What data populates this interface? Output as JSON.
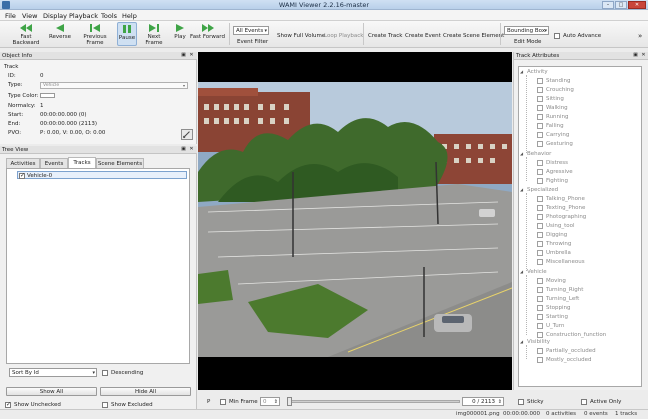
{
  "window": {
    "title": "WAMI Viewer 2.2.16-master"
  },
  "menu": [
    "File",
    "View",
    "Display",
    "Playback",
    "Tools",
    "Help"
  ],
  "toolbar": {
    "fast_backward": "Fast Backward",
    "reverse": "Reverse",
    "previous_frame": "Previous Frame",
    "pause": "Pause",
    "next_frame": "Next Frame",
    "play": "Play",
    "fast_forward": "Fast Forward",
    "event_filter_value": "All Events",
    "event_filter_label": "Event Filter",
    "show_full_volume": "Show Full Volume",
    "loop_playback": "Loop Playback",
    "create_track": "Create Track",
    "create_event": "Create Event",
    "create_scene_element": "Create Scene Element",
    "edit_mode_value": "Bounding Box",
    "edit_mode_label": "Edit Mode",
    "auto_advance": "Auto Advance",
    "overflow": "»"
  },
  "object_info": {
    "panel_title": "Object Info",
    "section": "Track",
    "id_label": "ID:",
    "id_value": "0",
    "type_label": "Type:",
    "type_value": "Vehicle",
    "type_color_label": "Type Color:",
    "normalcy_label": "Normalcy:",
    "normalcy_value": "1",
    "start_label": "Start:",
    "start_value": "00:00:00.000 (0)",
    "end_label": "End:",
    "end_value": "00:00:00.000 (2113)",
    "pvo_label": "PVO:",
    "pvo_value": "P: 0.00, V: 0.00, O: 0.00"
  },
  "tree_view": {
    "panel_title": "Tree View",
    "tabs": [
      "Activities",
      "Events",
      "Tracks",
      "Scene Elements"
    ],
    "active_tab": "Tracks",
    "items": [
      "Vehicle-0"
    ],
    "sort_value": "Sort By Id",
    "descending": "Descending",
    "show_all": "Show All",
    "hide_all": "Hide All",
    "show_unchecked": "Show Unchecked",
    "show_excluded": "Show Excluded"
  },
  "track_attributes": {
    "panel_title": "Track Attributes",
    "groups": [
      {
        "name": "Activity",
        "items": [
          "Standing",
          "Crouching",
          "Sitting",
          "Walking",
          "Running",
          "Falling",
          "Carrying",
          "Gesturing"
        ]
      },
      {
        "name": "Behavior",
        "items": [
          "Distress",
          "Agressive",
          "Fighting"
        ]
      },
      {
        "name": "Specialized",
        "items": [
          "Talking_Phone",
          "Texting_Phone",
          "Photographing",
          "Using_tool",
          "Digging",
          "Throwing",
          "Umbrella",
          "Miscellaneous"
        ]
      },
      {
        "name": "Vehicle",
        "items": [
          "Moving",
          "Turning_Right",
          "Turning_Left",
          "Stopping",
          "Starting",
          "U_Turn",
          "Construction_function"
        ]
      },
      {
        "name": "Visibility",
        "items": [
          "Partially_occluded",
          "Mostly_occluded"
        ]
      }
    ]
  },
  "player": {
    "p_label": "P",
    "min_frame": "Min Frame",
    "min_frame_value": "0",
    "frame_readout": "0 / 2113",
    "sticky": "Sticky",
    "active_only": "Active Only",
    "progress_fraction": 0
  },
  "status": {
    "file": "img000001.png",
    "time": "00:00:00.000",
    "activities": "0 activities",
    "events": "0 events",
    "tracks": "1 tracks"
  },
  "colors": {
    "accent": "#3fa447",
    "selection": "#e8f0fb",
    "video_bg": "#000000"
  }
}
